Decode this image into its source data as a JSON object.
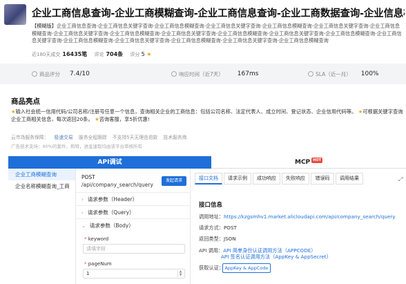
{
  "header": {
    "title": "企业工商信息查询-企业工商模糊查询-企业工商信息查询-企业工商数据查询-企业信息检索-信...",
    "desc_tag": "【模糊版】",
    "desc_text": "企业工商信息查询-企业工商信息关键字查询-企业工商信息模糊查询-企业工商信息关键字查询-企业工商信息模糊查询-企业工商信息关键字查询-企业工商信息模糊查询-企业工商信息关键字查询-企业工商信息模糊查询-企业工商信息关键字查询-企业工商信息模糊查询-企业工商信息关键字查询-企业工商信息模糊查询-企业工商信息关键字查询-企业工商信息模糊查询-企业工商信息关键字查询-企业工商信息模糊查询-企业工商信息关键字查询-企业工商信息模糊查询"
  },
  "stats": {
    "deals_label": "近180天成交",
    "deals_value": "16435笔",
    "reviews_label": "评论",
    "reviews_value": "704条",
    "score_label": "评分",
    "score_value": "5",
    "star_glyph": "★"
  },
  "metrics": [
    {
      "label": "商品评分",
      "value": "7.4/10"
    },
    {
      "label": "响应时间（近7天）",
      "value": "167ms"
    },
    {
      "label": "SLA（近一月）",
      "value": "100%"
    }
  ],
  "highlights": {
    "title": "商品亮点",
    "text1": "输入社会统一信用代码/公司名称/注册号任意一个信息，查询相关企业的工商信息：包括公司名称、法定代表人、成立时间、登记状态、企业信用代码等。",
    "text2": "可根据关键字查询企业工商相关信息，每次返回20条。",
    "text3": "咨询客服，享5折优惠!",
    "star": "★"
  },
  "guarantees": {
    "items": [
      "云市场服务保障：",
      "极速交易",
      "服务全程跟踪",
      "不支持5天无理由退款",
      "技术服务商"
    ],
    "fine": "广告技术支持：90%的案件，和特，进金速取均由该平台审核所有"
  },
  "tabs": {
    "api": "API调试",
    "mcp": "MCP",
    "mcp_badge": "HOT"
  },
  "left_list": [
    "企业工商模糊查询",
    "企业名称模糊查询_工商"
  ],
  "request": {
    "method": "POST",
    "path": "/api/company_search/query",
    "debug_button": "发起请求",
    "sections": [
      "请求参数（Header）",
      "请求参数（Query）",
      "请求参数（Body）"
    ],
    "fields": [
      {
        "label": "keyword",
        "placeholder": "请填字段",
        "value": ""
      },
      {
        "label": "pageNum",
        "placeholder": "",
        "value": "1"
      }
    ]
  },
  "right_tabs": [
    "接口文档",
    "请求示例",
    "成功响应",
    "失败响应",
    "错误码",
    "调用结果"
  ],
  "doc": {
    "title": "接口信息",
    "url_label": "调用地址：",
    "url": "https://kzgsmhv1.market.alicloudapi.com/api/company_search/query",
    "method_label": "请求方式：",
    "method": "POST",
    "return_label": "返回类型：",
    "return": "JSON",
    "auth_label": "API 调用：",
    "auth1": "API 简单身份认证调用方法（APPCODE）",
    "auth2": "API 签名认证调用方法（AppKey & AppSecret）",
    "get_label": "获取认证：",
    "get_button": "AppKey & AppCode"
  },
  "colors": {
    "accent": "#1e6fd9",
    "star": "#e6a817",
    "hot": "#e84c3d"
  }
}
